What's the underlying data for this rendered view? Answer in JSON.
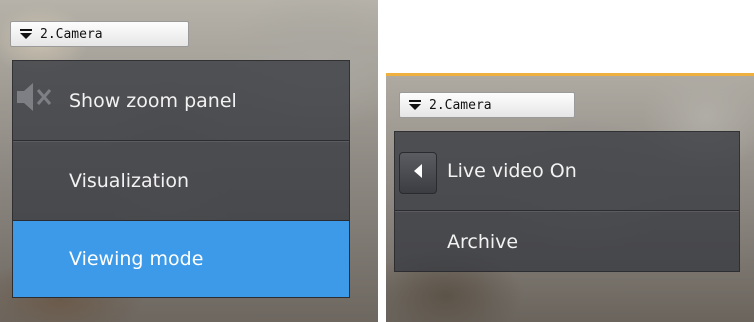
{
  "left_panel": {
    "camera_button": {
      "label": "2.Camera",
      "icon": "dropdown-arrow-icon"
    },
    "menu": {
      "items": [
        {
          "label": "Show zoom panel",
          "active": false
        },
        {
          "label": "Visualization",
          "active": false
        },
        {
          "label": "Viewing mode",
          "active": true
        }
      ],
      "mute_icon": "speaker-muted-icon"
    }
  },
  "right_panel": {
    "camera_button": {
      "label": "2.Camera",
      "icon": "dropdown-arrow-icon"
    },
    "menu": {
      "back_icon": "chevron-left-icon",
      "items": [
        {
          "label": "Live video On",
          "active": false
        },
        {
          "label": "Archive",
          "active": false
        }
      ]
    }
  },
  "colors": {
    "active_item": "#3d9ae8",
    "menu_background": "#3a3c42",
    "accent_border": "#f0b040"
  }
}
